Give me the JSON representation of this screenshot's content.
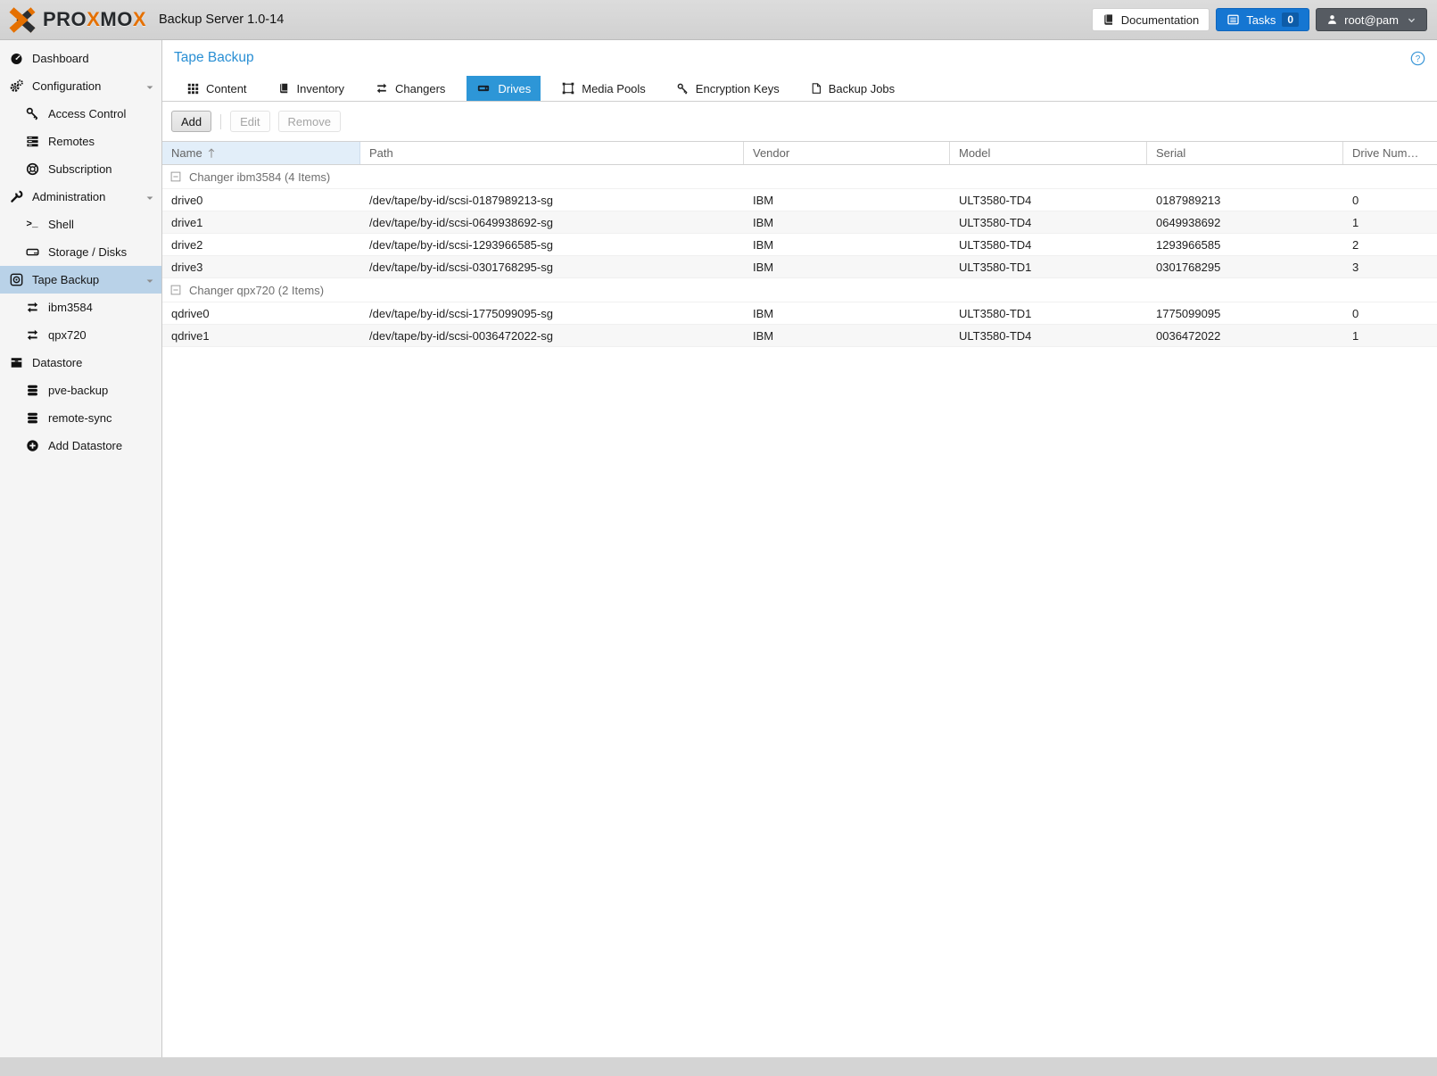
{
  "topbar": {
    "logo_pre": "PRO",
    "logo_x1": "X",
    "logo_mid": "MO",
    "logo_x2": "X",
    "product": "Backup Server 1.0-14",
    "documentation_label": "Documentation",
    "tasks_label": "Tasks",
    "tasks_count": "0",
    "user_label": "root@pam"
  },
  "sidebar": {
    "items": [
      {
        "label": "Dashboard"
      },
      {
        "label": "Configuration"
      },
      {
        "label": "Access Control"
      },
      {
        "label": "Remotes"
      },
      {
        "label": "Subscription"
      },
      {
        "label": "Administration"
      },
      {
        "label": "Shell"
      },
      {
        "label": "Storage / Disks"
      },
      {
        "label": "Tape Backup"
      },
      {
        "label": "ibm3584"
      },
      {
        "label": "qpx720"
      },
      {
        "label": "Datastore"
      },
      {
        "label": "pve-backup"
      },
      {
        "label": "remote-sync"
      },
      {
        "label": "Add Datastore"
      }
    ]
  },
  "main": {
    "title": "Tape Backup",
    "tabs": [
      {
        "label": "Content"
      },
      {
        "label": "Inventory"
      },
      {
        "label": "Changers"
      },
      {
        "label": "Drives"
      },
      {
        "label": "Media Pools"
      },
      {
        "label": "Encryption Keys"
      },
      {
        "label": "Backup Jobs"
      }
    ],
    "toolbar": {
      "add": "Add",
      "edit": "Edit",
      "remove": "Remove"
    },
    "table": {
      "columns": [
        "Name",
        "Path",
        "Vendor",
        "Model",
        "Serial",
        "Drive Num…"
      ],
      "groups": [
        {
          "header": "Changer ibm3584 (4 Items)",
          "rows": [
            [
              "drive0",
              "/dev/tape/by-id/scsi-0187989213-sg",
              "IBM",
              "ULT3580-TD4",
              "0187989213",
              "0"
            ],
            [
              "drive1",
              "/dev/tape/by-id/scsi-0649938692-sg",
              "IBM",
              "ULT3580-TD4",
              "0649938692",
              "1"
            ],
            [
              "drive2",
              "/dev/tape/by-id/scsi-1293966585-sg",
              "IBM",
              "ULT3580-TD4",
              "1293966585",
              "2"
            ],
            [
              "drive3",
              "/dev/tape/by-id/scsi-0301768295-sg",
              "IBM",
              "ULT3580-TD1",
              "0301768295",
              "3"
            ]
          ]
        },
        {
          "header": "Changer qpx720 (2 Items)",
          "rows": [
            [
              "qdrive0",
              "/dev/tape/by-id/scsi-1775099095-sg",
              "IBM",
              "ULT3580-TD1",
              "1775099095",
              "0"
            ],
            [
              "qdrive1",
              "/dev/tape/by-id/scsi-0036472022-sg",
              "IBM",
              "ULT3580-TD4",
              "0036472022",
              "1"
            ]
          ]
        }
      ]
    }
  },
  "colors": {
    "accent_blue": "#2d96d7",
    "title_blue": "#2a8fd4",
    "tasks_blue": "#1576d2",
    "logo_orange": "#e57000",
    "nav_selected_bg": "#b9d2e8",
    "sorted_column_bg": "#e2eef9"
  }
}
